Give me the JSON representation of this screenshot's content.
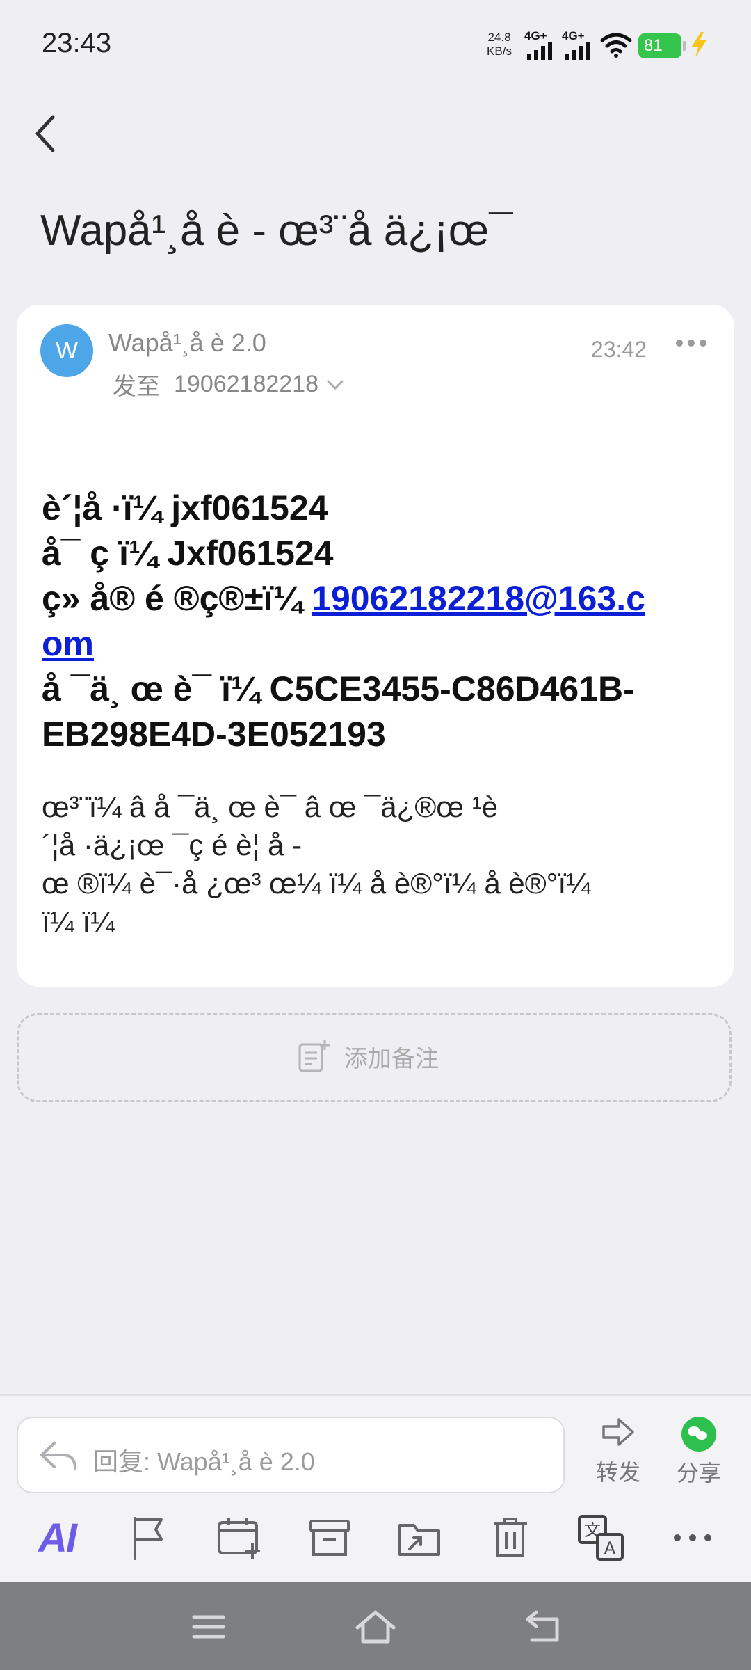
{
  "status_bar": {
    "time": "23:43",
    "net_speed_value": "24.8",
    "net_speed_unit": "KB/s",
    "signal_1_label": "4G+",
    "signal_2_label": "4G+",
    "battery_level": "81"
  },
  "header": {
    "title": "Wapå¹¸å è  - œ³¨å  ä¿¡œ¯"
  },
  "message": {
    "avatar_letter": "W",
    "sender": "Wapå¹¸å è  2.0",
    "recipient_prefix": "发至",
    "recipient": "19062182218",
    "time": "23:42",
    "body_lines": {
      "line1": "è´¦å ·ï¼ jxf061524",
      "line2": "å¯ ç  ï¼ Jxf061524",
      "line3_prefix": "ç» å® é ®ç®±ï¼ ",
      "line3_link_a": "19062182218@163.c",
      "line3_link_b": "om",
      "line4": "å ¯ä¸ œ è¯ ï¼ C5CE3455-C86D461B-",
      "line5": "EB298E4D-3E052193"
    },
    "notice_lines": {
      "line1": "œ³¨ï¼ â  å ¯ä¸ œ è¯ â   œ ¯ä¿®œ ¹è",
      "line2": "´¦å ·ä¿¡œ ¯ç  é  è¦ å  -",
      "line3": "œ ®ï¼ è¯·å ¿œ³ œ¼ ï¼ å  è®°ï¼ å  è®°ï¼",
      "line4": " ï¼ ï¼"
    }
  },
  "note_button": {
    "label": "添加备注"
  },
  "reply_bar": {
    "placeholder": "回复: Wapå¹¸å è  2.0",
    "forward_label": "转发",
    "share_label": "分享"
  },
  "toolbar": {
    "ai_label": "AI"
  }
}
